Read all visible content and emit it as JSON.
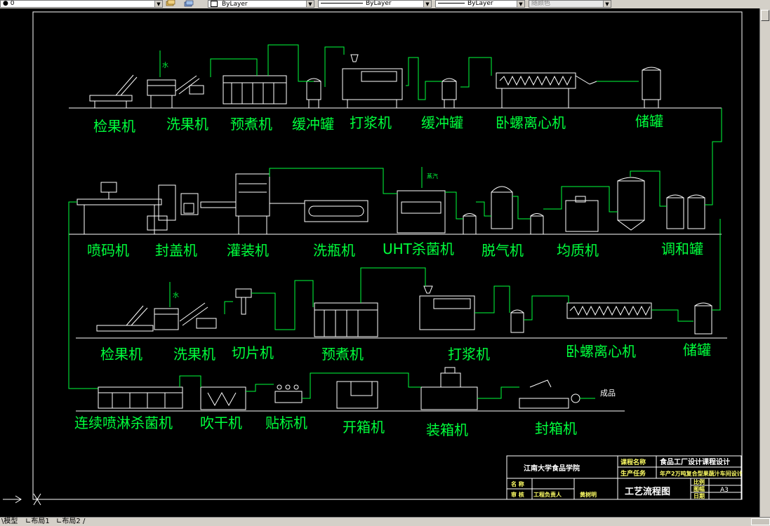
{
  "toolbar": {
    "layer_value": "0",
    "color_value": "ByLayer",
    "linetype_value": "ByLayer",
    "lineweight_value": "ByLayer",
    "plotstyle_value": "随颜色"
  },
  "drawing": {
    "row1_labels": [
      "检果机",
      "洗果机",
      "预煮机",
      "缓冲罐",
      "打浆机",
      "缓冲罐",
      "卧螺离心机",
      "储罐"
    ],
    "row2_labels": [
      "喷码机",
      "封盖机",
      "灌装机",
      "洗瓶机",
      "UHT杀菌机",
      "脱气机",
      "均质机",
      "调和罐"
    ],
    "row3_labels": [
      "检果机",
      "洗果机",
      "切片机",
      "预煮机",
      "打浆机",
      "卧螺离心机",
      "储罐"
    ],
    "row4_labels": [
      "连续喷淋杀菌机",
      "吹干机",
      "贴标机",
      "开箱机",
      "装箱机",
      "封箱机"
    ],
    "annotations": {
      "water1": "水",
      "water2": "水",
      "steam": "蒸汽",
      "product": "成品"
    },
    "title_block": {
      "school": "江南大学食品学院",
      "project_label": "课程名称",
      "project": "食品工厂设计课程设计",
      "product_label": "生产任务",
      "product": "年产2万吨复合型果蔬汁车间设计",
      "row_name": "名 称",
      "row_review": "审 核",
      "row_head": "工程负责人",
      "signature": "黄树明",
      "title": "工艺流程图",
      "scale_label": "比例",
      "sheet_label": "图幅",
      "sheet": "A3",
      "date_label": "日期"
    }
  },
  "layout_tabs": {
    "model": "模型",
    "layout1": "布局1",
    "layout2": "布局2"
  }
}
